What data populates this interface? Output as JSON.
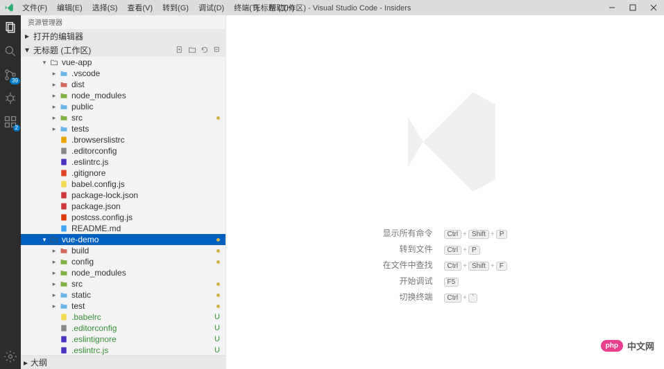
{
  "titlebar": {
    "menus": [
      "文件(F)",
      "编辑(E)",
      "选择(S)",
      "查看(V)",
      "转到(G)",
      "调试(D)",
      "终端(T)",
      "帮助(H)"
    ],
    "title": "无标题 (工作区) - Visual Studio Code - Insiders"
  },
  "activitybar": {
    "scm_badge": "39",
    "ext_badge": "2"
  },
  "sidebar": {
    "title": "资源管理器",
    "open_editors": "打开的编辑器",
    "workspace": "无标题 (工作区)",
    "outline": "大纲",
    "tree": [
      {
        "d": 2,
        "t": "folder-open",
        "c": true,
        "lbl": "vue-app",
        "expanded": true,
        "outline": true
      },
      {
        "d": 3,
        "t": "folder",
        "c": true,
        "lbl": ".vscode",
        "col": "#6cb2e4"
      },
      {
        "d": 3,
        "t": "folder",
        "c": true,
        "lbl": "dist",
        "col": "#d26a5c"
      },
      {
        "d": 3,
        "t": "folder",
        "c": true,
        "lbl": "node_modules",
        "col": "#7cb342"
      },
      {
        "d": 3,
        "t": "folder",
        "c": true,
        "lbl": "public",
        "col": "#6cb2e4"
      },
      {
        "d": 3,
        "t": "folder",
        "c": true,
        "lbl": "src",
        "col": "#7cb342",
        "gitdot": true
      },
      {
        "d": 3,
        "t": "folder",
        "c": true,
        "lbl": "tests",
        "col": "#6cb2e4"
      },
      {
        "d": 3,
        "t": "file",
        "lbl": ".browserslistrc",
        "icon": "browsers"
      },
      {
        "d": 3,
        "t": "file",
        "lbl": ".editorconfig",
        "icon": "editorconfig"
      },
      {
        "d": 3,
        "t": "file",
        "lbl": ".eslintrc.js",
        "icon": "eslint"
      },
      {
        "d": 3,
        "t": "file",
        "lbl": ".gitignore",
        "icon": "git"
      },
      {
        "d": 3,
        "t": "file",
        "lbl": "babel.config.js",
        "icon": "babel"
      },
      {
        "d": 3,
        "t": "file",
        "lbl": "package-lock.json",
        "icon": "npm"
      },
      {
        "d": 3,
        "t": "file",
        "lbl": "package.json",
        "icon": "npm"
      },
      {
        "d": 3,
        "t": "file",
        "lbl": "postcss.config.js",
        "icon": "postcss"
      },
      {
        "d": 3,
        "t": "file",
        "lbl": "README.md",
        "icon": "info"
      },
      {
        "d": 2,
        "t": "folder-open",
        "c": true,
        "lbl": "vue-demo",
        "expanded": true,
        "outline": true,
        "selected": true,
        "gitdot": true
      },
      {
        "d": 3,
        "t": "folder",
        "c": true,
        "lbl": "build",
        "col": "#d26a5c",
        "gitdot": true
      },
      {
        "d": 3,
        "t": "folder",
        "c": true,
        "lbl": "config",
        "col": "#7cb342",
        "gitdot": true
      },
      {
        "d": 3,
        "t": "folder",
        "c": true,
        "lbl": "node_modules",
        "col": "#7cb342"
      },
      {
        "d": 3,
        "t": "folder",
        "c": true,
        "lbl": "src",
        "col": "#7cb342",
        "gitdot": true
      },
      {
        "d": 3,
        "t": "folder",
        "c": true,
        "lbl": "static",
        "col": "#6cb2e4",
        "gitdot": true
      },
      {
        "d": 3,
        "t": "folder",
        "c": true,
        "lbl": "test",
        "col": "#6cb2e4",
        "gitdot": true
      },
      {
        "d": 3,
        "t": "file",
        "lbl": ".babelrc",
        "icon": "babel",
        "gitu": true
      },
      {
        "d": 3,
        "t": "file",
        "lbl": ".editorconfig",
        "icon": "editorconfig",
        "gitu": true
      },
      {
        "d": 3,
        "t": "file",
        "lbl": ".eslintignore",
        "icon": "eslint",
        "gitu": true
      },
      {
        "d": 3,
        "t": "file",
        "lbl": ".eslintrc.js",
        "icon": "eslint",
        "gitu": true
      }
    ]
  },
  "welcome": {
    "shortcuts": [
      {
        "label": "显示所有命令",
        "keys": [
          "Ctrl",
          "Shift",
          "P"
        ]
      },
      {
        "label": "转到文件",
        "keys": [
          "Ctrl",
          "P"
        ]
      },
      {
        "label": "在文件中查找",
        "keys": [
          "Ctrl",
          "Shift",
          "F"
        ]
      },
      {
        "label": "开始调试",
        "keys": [
          "F5"
        ]
      },
      {
        "label": "切换终端",
        "keys": [
          "Ctrl",
          "`"
        ]
      }
    ]
  },
  "footer": {
    "brand": "php",
    "text": "中文网"
  },
  "glyphs": {
    "U": "U"
  }
}
